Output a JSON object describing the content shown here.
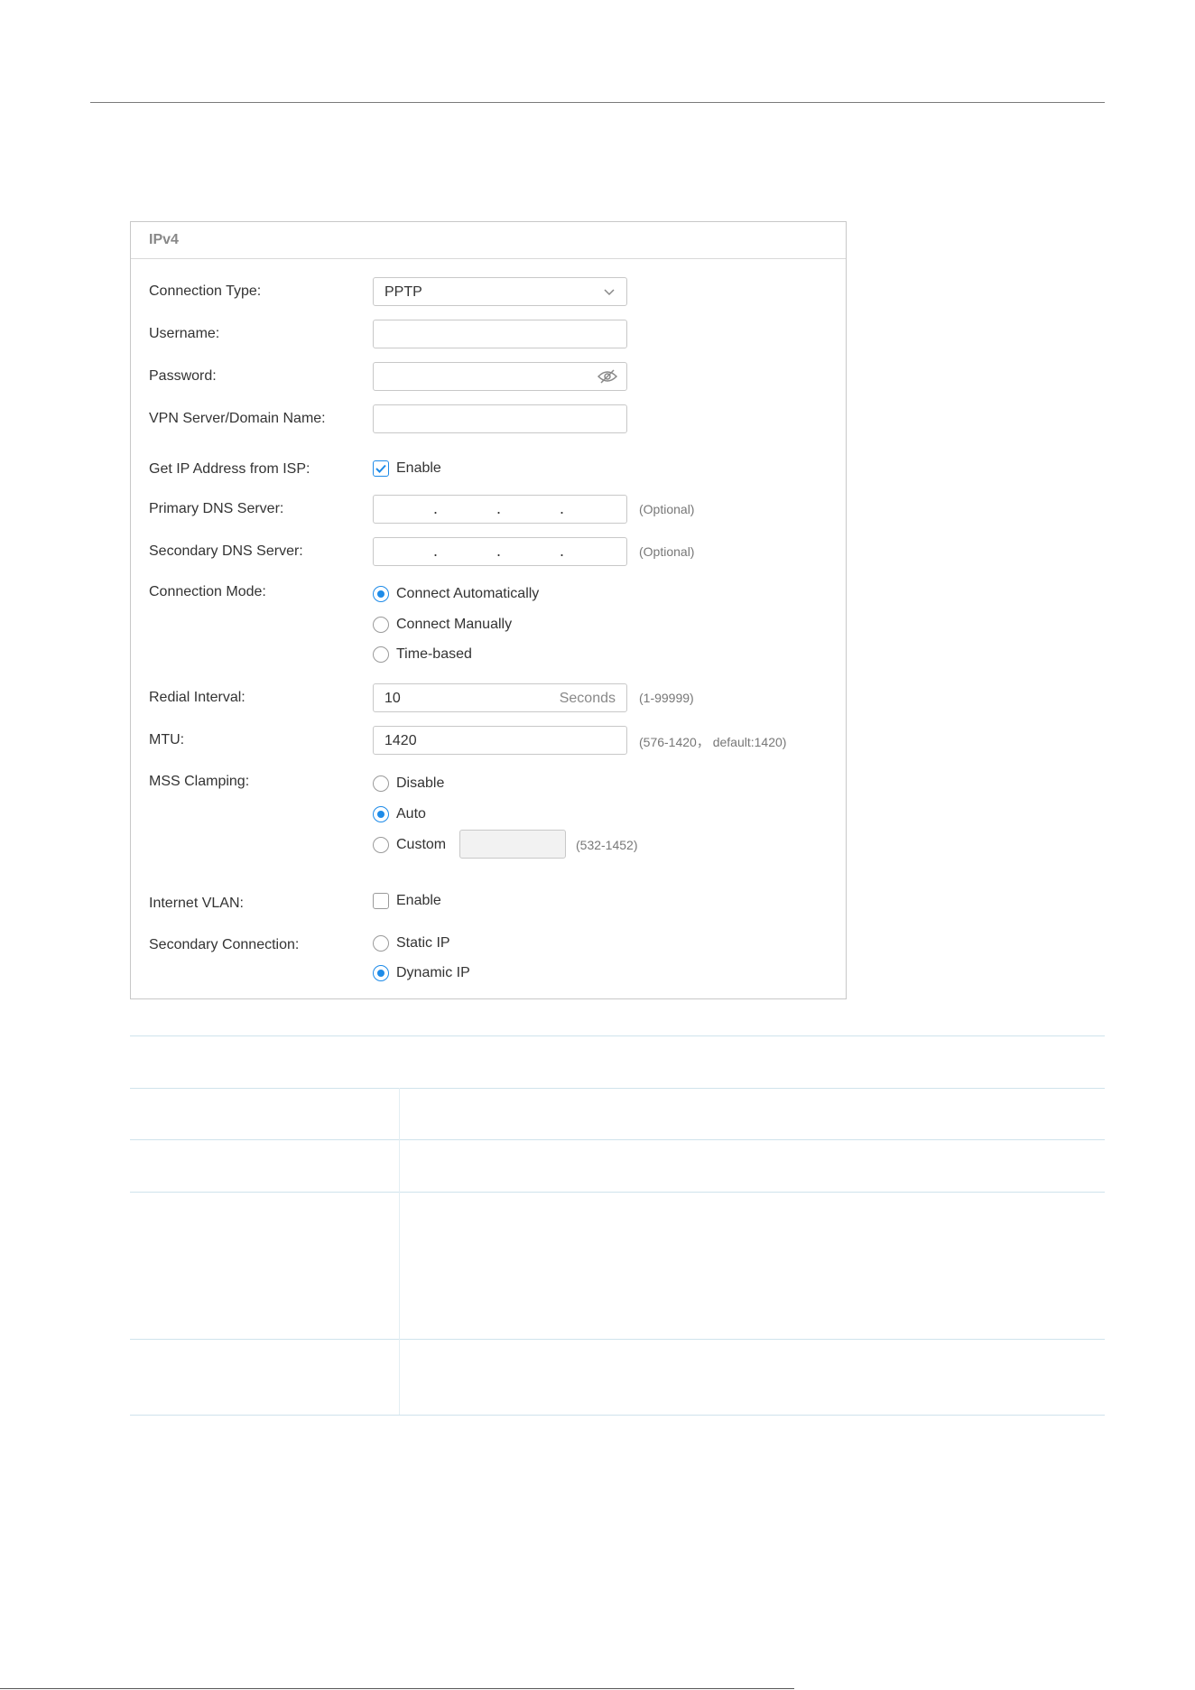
{
  "panel": {
    "title": "IPv4"
  },
  "fields": {
    "connection_type": {
      "label": "Connection Type:",
      "value": "PPTP"
    },
    "username": {
      "label": "Username:",
      "value": ""
    },
    "password": {
      "label": "Password:",
      "value": ""
    },
    "vpn_server": {
      "label": "VPN Server/Domain Name:",
      "value": ""
    },
    "get_ip": {
      "label": "Get IP Address from ISP:",
      "option": "Enable",
      "checked": true
    },
    "primary_dns": {
      "label": "Primary DNS Server:",
      "hint": "(Optional)"
    },
    "secondary_dns": {
      "label": "Secondary DNS Server:",
      "hint": "(Optional)"
    },
    "connection_mode": {
      "label": "Connection Mode:",
      "options": [
        "Connect Automatically",
        "Connect Manually",
        "Time-based"
      ],
      "selected": "Connect Automatically"
    },
    "redial_interval": {
      "label": "Redial Interval:",
      "value": "10",
      "unit": "Seconds",
      "hint": "(1-99999)"
    },
    "mtu": {
      "label": "MTU:",
      "value": "1420",
      "hint": "(576-1420， default:1420)"
    },
    "mss_clamping": {
      "label": "MSS Clamping:",
      "options": [
        "Disable",
        "Auto",
        "Custom"
      ],
      "selected": "Auto",
      "custom_hint": "(532-1452)"
    },
    "internet_vlan": {
      "label": "Internet VLAN:",
      "option": "Enable",
      "checked": false
    },
    "secondary_connection": {
      "label": "Secondary Connection:",
      "options": [
        "Static IP",
        "Dynamic IP"
      ],
      "selected": "Dynamic IP"
    }
  },
  "colors": {
    "accent": "#1e8be8",
    "border": "#c8c8c8",
    "table_line": "#cfe3ec"
  },
  "icons": {
    "select": "chevron-down-icon",
    "password": "eye-off-icon",
    "checkbox": "checkmark-icon"
  }
}
